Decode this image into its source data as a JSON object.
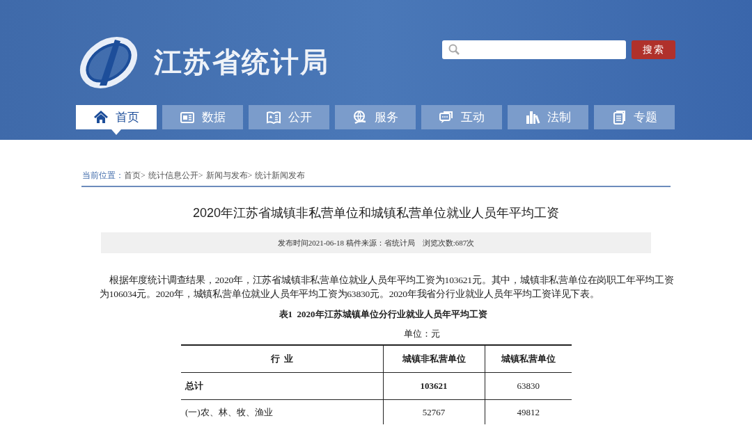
{
  "header": {
    "site_title": "江苏省统计局",
    "search_button": "搜索"
  },
  "nav": [
    {
      "label": "首页",
      "kind": "home",
      "selected": true
    },
    {
      "label": "数据",
      "kind": "news",
      "selected": false
    },
    {
      "label": "公开",
      "kind": "book",
      "selected": false
    },
    {
      "label": "服务",
      "kind": "globe",
      "selected": false
    },
    {
      "label": "互动",
      "kind": "chat",
      "selected": false
    },
    {
      "label": "法制",
      "kind": "books",
      "selected": false
    },
    {
      "label": "专题",
      "kind": "doc",
      "selected": false
    }
  ],
  "breadcrumb": {
    "label": "当前位置：",
    "separator": ">",
    "items": [
      "首页",
      "统计信息公开",
      "新闻与发布",
      "统计新闻发布"
    ]
  },
  "article": {
    "title": "2020年江苏省城镇非私营单位和城镇私营单位就业人员年平均工资",
    "meta": "发布时间2021-06-18 稿件来源：省统计局　浏览次数:687次",
    "paragraph": "根据年度统计调查结果，2020年，江苏省城镇非私营单位就业人员年平均工资为103621元。其中，城镇非私营单位在岗职工年平均工资为106034元。2020年，城镇私营单位就业人员年平均工资为63830元。2020年我省分行业就业人员年平均工资详见下表。",
    "table_caption": "表1  2020年江苏城镇单位分行业就业人员年平均工资",
    "unit": "单位：元",
    "table": {
      "columns": [
        "行  业",
        "城镇非私营单位",
        "城镇私营单位"
      ],
      "rows": [
        {
          "cells": [
            "总计",
            "103621",
            "63830"
          ],
          "bold": true
        },
        {
          "cells": [
            "(一)农、林、牧、渔业",
            "52767",
            "49812"
          ],
          "bold": false
        }
      ]
    }
  }
}
